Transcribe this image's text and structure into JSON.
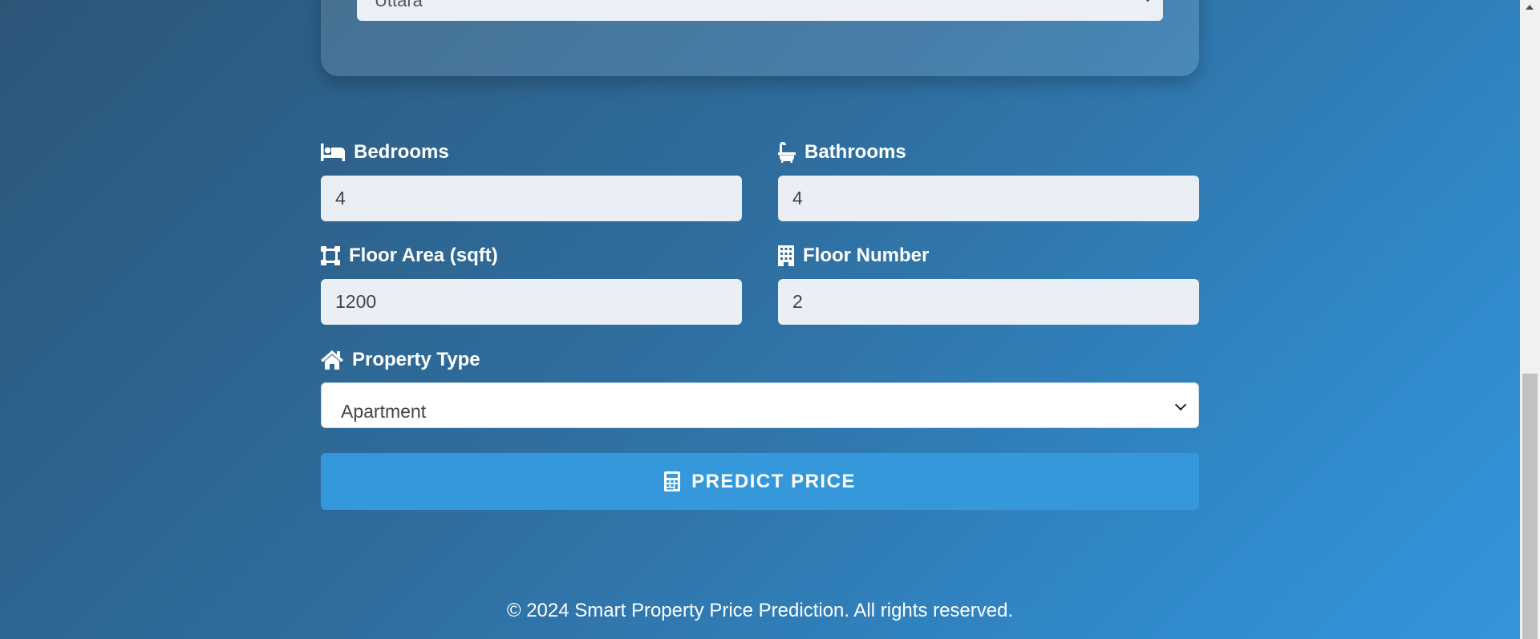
{
  "location": {
    "value": "Uttara"
  },
  "fields": {
    "bedrooms": {
      "label": "Bedrooms",
      "value": "4"
    },
    "bathrooms": {
      "label": "Bathrooms",
      "value": "4"
    },
    "floor_area": {
      "label": "Floor Area (sqft)",
      "value": "1200"
    },
    "floor_number": {
      "label": "Floor Number",
      "value": "2"
    },
    "property_type": {
      "label": "Property Type",
      "selected": "Apartment"
    }
  },
  "predict_button": {
    "label": "PREDICT PRICE",
    "icon": "calculator-icon"
  },
  "footer": {
    "text": "© 2024 Smart Property Price Prediction. All rights reserved."
  },
  "colors": {
    "accent": "#3498db",
    "input_bg": "#e9eff5",
    "text": "#ffffff"
  }
}
